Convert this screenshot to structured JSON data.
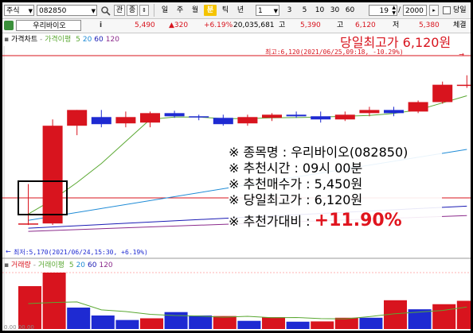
{
  "toolbar": {
    "market_select": "주식",
    "code_input": "082850",
    "tab_relation": "관",
    "tab_chart": "종",
    "timeframes": [
      "일",
      "주",
      "월",
      "분",
      "틱",
      "년"
    ],
    "active_timeframe": "분",
    "minute_unit": "1",
    "minute_presets": [
      "3",
      "5",
      "10",
      "30",
      "60"
    ],
    "display_count": "19",
    "total_count": "2000",
    "today_only_label": "당일"
  },
  "quote_bar": {
    "stock_name": "우리바이오",
    "info_icon": "i",
    "price": "5,490",
    "change": "▲320",
    "change_rate": "+6.19%",
    "volume": "20,035,681",
    "high_tag": "고",
    "high": "5,390",
    "low_tag": "고",
    "low": "6,120",
    "close_tag": "저",
    "close": "5,380",
    "cut_label": "체결"
  },
  "price_panel": {
    "title": "가격차트",
    "ma_label": "가격이평",
    "ma_periods": [
      "5",
      "20",
      "60",
      "120"
    ],
    "ma_colors": [
      "#5aa832",
      "#1e8bd6",
      "#1a1ab4",
      "#8b2a8b"
    ],
    "high_marker": "최고:6,120(2021/06/25,09:18, -10.29%)",
    "low_marker": "최저:5,170(2021/06/24,15:30, +6.19%)",
    "headline": "당일최고가 6,120원"
  },
  "annotation": {
    "lines": [
      "※ 종목명 : 우리바이오(082850)",
      "※ 추천시간 : 09시 00분",
      "※ 추천매수가 : 5,450원",
      "※ 당일최고가 : 6,120원"
    ],
    "last_label": "※ 추천가대비 : ",
    "last_value": "+11.90%"
  },
  "volume_panel": {
    "title": "거래량",
    "ma_label": "거래이평",
    "ma_periods": [
      "5",
      "20",
      "60",
      "120"
    ],
    "ma_colors": [
      "#5aa832",
      "#1e8bd6",
      "#1a1ab4",
      "#8b2a8b"
    ],
    "bottom_label": "0.00 00.00"
  },
  "colors": {
    "up": "#d8141e",
    "down": "#1e2ad2",
    "highlight": "#f5c400"
  },
  "chart_data": [
    {
      "type": "candlestick",
      "title": "가격차트",
      "unit": "KRW",
      "ylim": [
        5080,
        6280
      ],
      "candles": [
        {
          "o": 5180,
          "h": 5430,
          "l": 5170,
          "c": 5180
        },
        {
          "o": 5180,
          "h": 5840,
          "l": 5170,
          "c": 5800
        },
        {
          "o": 5800,
          "h": 5900,
          "l": 5740,
          "c": 5900
        },
        {
          "o": 5855,
          "h": 5900,
          "l": 5790,
          "c": 5810
        },
        {
          "o": 5815,
          "h": 5890,
          "l": 5790,
          "c": 5855
        },
        {
          "o": 5820,
          "h": 5890,
          "l": 5790,
          "c": 5880
        },
        {
          "o": 5880,
          "h": 5895,
          "l": 5850,
          "c": 5860
        },
        {
          "o": 5860,
          "h": 5870,
          "l": 5835,
          "c": 5855
        },
        {
          "o": 5850,
          "h": 5870,
          "l": 5800,
          "c": 5810
        },
        {
          "o": 5815,
          "h": 5870,
          "l": 5800,
          "c": 5855
        },
        {
          "o": 5850,
          "h": 5880,
          "l": 5830,
          "c": 5870
        },
        {
          "o": 5870,
          "h": 5890,
          "l": 5850,
          "c": 5860
        },
        {
          "o": 5860,
          "h": 5890,
          "l": 5820,
          "c": 5840
        },
        {
          "o": 5840,
          "h": 5890,
          "l": 5830,
          "c": 5870
        },
        {
          "o": 5880,
          "h": 5920,
          "l": 5860,
          "c": 5900
        },
        {
          "o": 5900,
          "h": 5920,
          "l": 5860,
          "c": 5880
        },
        {
          "o": 5890,
          "h": 5960,
          "l": 5880,
          "c": 5950
        },
        {
          "o": 5950,
          "h": 6080,
          "l": 5940,
          "c": 6060
        },
        {
          "o": 6060,
          "h": 6120,
          "l": 6040,
          "c": 6060
        }
      ],
      "ma5": [
        5240,
        5330,
        5440,
        5560,
        5700,
        5840,
        5855,
        5855,
        5845,
        5845,
        5850,
        5852,
        5855,
        5860,
        5865,
        5878,
        5900,
        5945,
        5990
      ],
      "ma20_end": [
        5200,
        5650
      ],
      "ma60_end": [
        5150,
        5290
      ],
      "ma120_end": [
        5130,
        5230
      ]
    },
    {
      "type": "bar",
      "title": "거래량",
      "values": [
        760,
        1000,
        380,
        240,
        160,
        190,
        300,
        240,
        230,
        145,
        210,
        130,
        135,
        200,
        200,
        510,
        350,
        440,
        500
      ],
      "colors": [
        "up",
        "up",
        "down",
        "down",
        "down",
        "up",
        "down",
        "down",
        "up",
        "down",
        "up",
        "down",
        "up",
        "up",
        "down",
        "up",
        "down",
        "up",
        "up"
      ],
      "ma5": [
        450,
        470,
        480,
        340,
        310,
        260,
        240,
        230,
        210,
        225,
        200,
        205,
        185,
        180,
        220,
        270,
        300,
        330,
        390
      ]
    }
  ]
}
